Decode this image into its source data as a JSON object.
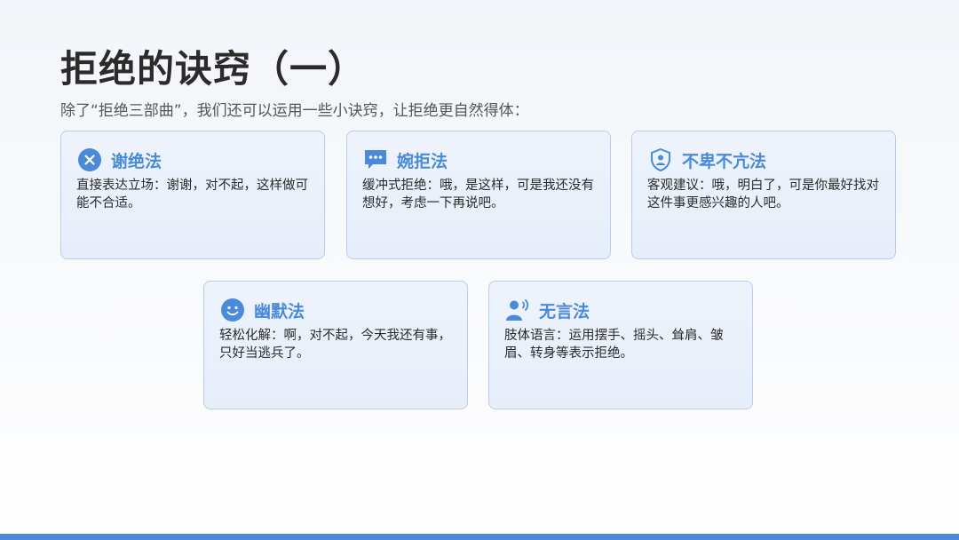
{
  "title": "拒绝的诀窍（一）",
  "subtitle": "除了“拒绝三部曲”，我们还可以运用一些小诀窍，让拒绝更自然得体：",
  "accent_color": "#4a8ad8",
  "cards": [
    {
      "icon": "close-circle-icon",
      "title": "谢绝法",
      "text": "直接表达立场：谢谢，对不起，这样做可能不合适。"
    },
    {
      "icon": "speech-bubble-icon",
      "title": "婉拒法",
      "text": "缓冲式拒绝：哦，是这样，可是我还没有想好，考虑一下再说吧。"
    },
    {
      "icon": "shield-person-icon",
      "title": "不卑不亢法",
      "text": "客观建议：哦，明白了，可是你最好找对这件事更感兴趣的人吧。"
    },
    {
      "icon": "smiley-face-icon",
      "title": "幽默法",
      "text": "轻松化解：啊，对不起，今天我还有事，只好当逃兵了。"
    },
    {
      "icon": "person-speaking-icon",
      "title": "无言法",
      "text": "肢体语言：运用摆手、摇头、耸肩、皱眉、转身等表示拒绝。"
    }
  ]
}
